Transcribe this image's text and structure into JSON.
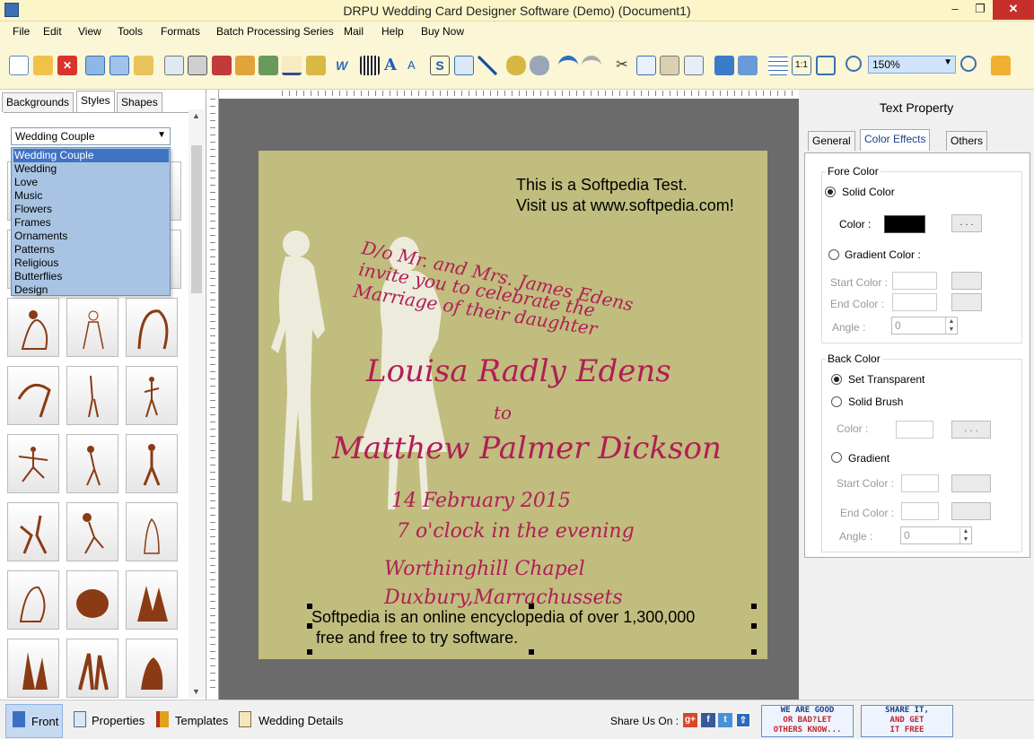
{
  "window": {
    "title": "DRPU Wedding Card Designer Software (Demo) (Document1)",
    "min": "–",
    "max": "❐",
    "close": "✕"
  },
  "menu": [
    "File",
    "Edit",
    "View",
    "Tools",
    "Formats",
    "Batch Processing Series",
    "Mail",
    "Help",
    "Buy Now"
  ],
  "toolbar": {
    "zoom": "150%"
  },
  "left_panel": {
    "tabs": [
      "Backgrounds",
      "Styles",
      "Shapes"
    ],
    "active_tab": "Styles",
    "style_select": "Wedding Couple",
    "style_options": [
      "Wedding Couple",
      "Wedding",
      "Love",
      "Music",
      "Flowers",
      "Frames",
      "Ornaments",
      "Patterns",
      "Religious",
      "Butterflies",
      "Design"
    ]
  },
  "card": {
    "test_line1": "This is a Softpedia Test.",
    "test_line2": "Visit us at www.softpedia.com!",
    "invite1": "D/o Mr. and Mrs. James Edens",
    "invite2": "invite you to celebrate the",
    "invite3": "Marriage of their daughter",
    "bride": "Louisa   Radly   Edens",
    "to": "to",
    "groom": "Matthew   Palmer   Dickson",
    "date": "14 February 2015",
    "time": "7 o'clock in the evening",
    "venue": "Worthinghill Chapel",
    "place": "Duxbury,Marrachussets",
    "footer1": "Softpedia is an online encyclopedia of over 1,300,000",
    "footer2": "free and free to try software.",
    "colors": {
      "background": "#c0bd7e",
      "accent": "#b11e56",
      "silhouette": "#ecebdc"
    }
  },
  "text_property": {
    "title": "Text Property",
    "tabs": [
      "General",
      "Color Effects",
      "Others"
    ],
    "fore_color": {
      "label": "Fore Color",
      "solid": "Solid Color",
      "color_label": "Color :",
      "color_value": "#000000",
      "browse": ". . .",
      "gradient": "Gradient Color :",
      "start": "Start Color :",
      "end": "End Color :",
      "angle": "Angle :",
      "angle_value": "0"
    },
    "back_color": {
      "label": "Back Color",
      "transparent": "Set Transparent",
      "brush": "Solid Brush",
      "color_label": "Color :",
      "browse": ". . .",
      "gradient": "Gradient",
      "start": "Start Color :",
      "end": "End Color :",
      "angle": "Angle :",
      "angle_value": "0"
    }
  },
  "statusbar": {
    "items": [
      "Front",
      "Properties",
      "Templates",
      "Wedding Details"
    ],
    "share": "Share Us On :",
    "banner1": [
      "WE ARE GOOD",
      "OR BAD?LET",
      "OTHERS KNOW..."
    ],
    "banner2": [
      "SHARE IT,",
      "AND GET",
      "IT FREE"
    ]
  }
}
